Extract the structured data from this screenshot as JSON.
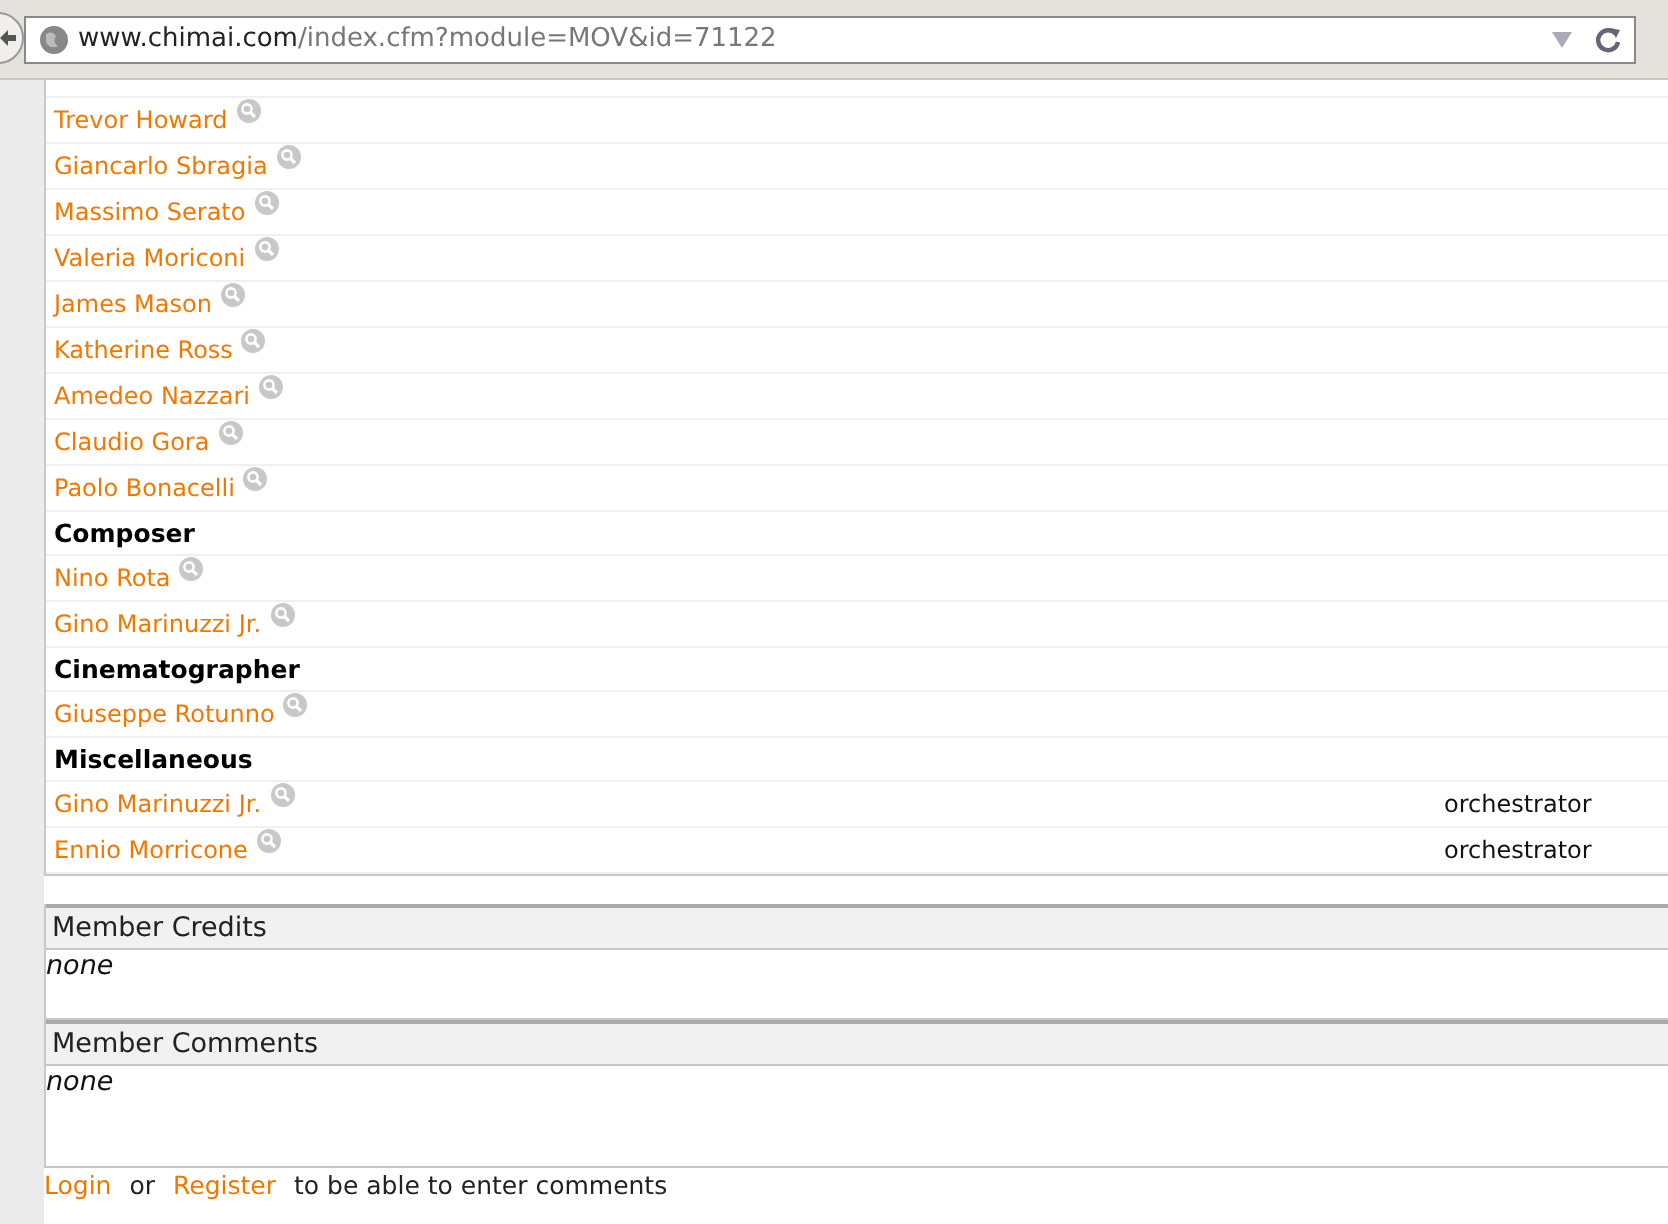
{
  "browser": {
    "url_host": "www.chimai.com",
    "url_path": "/index.cfm?module=MOV&id=71122"
  },
  "credits": [
    {
      "kind": "person",
      "name": "Trevor Howard"
    },
    {
      "kind": "person",
      "name": "Giancarlo Sbragia"
    },
    {
      "kind": "person",
      "name": "Massimo Serato"
    },
    {
      "kind": "person",
      "name": "Valeria Moriconi"
    },
    {
      "kind": "person",
      "name": "James Mason"
    },
    {
      "kind": "person",
      "name": "Katherine Ross"
    },
    {
      "kind": "person",
      "name": "Amedeo Nazzari"
    },
    {
      "kind": "person",
      "name": "Claudio Gora"
    },
    {
      "kind": "person",
      "name": "Paolo Bonacelli"
    },
    {
      "kind": "heading",
      "name": "Composer"
    },
    {
      "kind": "person",
      "name": "Nino Rota"
    },
    {
      "kind": "person",
      "name": "Gino Marinuzzi Jr."
    },
    {
      "kind": "heading",
      "name": "Cinematographer"
    },
    {
      "kind": "person",
      "name": "Giuseppe Rotunno"
    },
    {
      "kind": "heading",
      "name": "Miscellaneous"
    },
    {
      "kind": "person",
      "name": "Gino Marinuzzi Jr.",
      "role": "orchestrator"
    },
    {
      "kind": "person",
      "name": "Ennio Morricone",
      "role": "orchestrator"
    }
  ],
  "sections": [
    {
      "title": "Member Credits",
      "body": "none"
    },
    {
      "title": "Member Comments",
      "body": "none"
    }
  ],
  "footer": {
    "login": "Login",
    "or": "or",
    "register": "Register",
    "rest": "to be able to enter comments"
  }
}
